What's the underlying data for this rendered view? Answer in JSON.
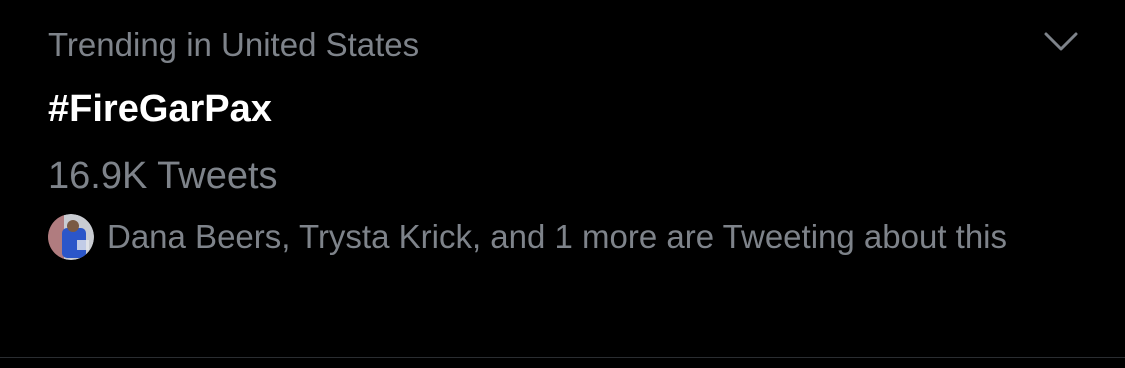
{
  "trend": {
    "context": "Trending in United States",
    "hashtag": "#FireGarPax",
    "tweet_count": "16.9K Tweets",
    "social_context": "Dana Beers, Trysta Krick, and 1 more are Tweeting about this",
    "menu_icon": "chevron-down-icon",
    "avatar_icon": "avatar"
  },
  "colors": {
    "background": "#000000",
    "primary_text": "#ffffff",
    "secondary_text": "#7e838a",
    "divider": "#2a2d31"
  }
}
